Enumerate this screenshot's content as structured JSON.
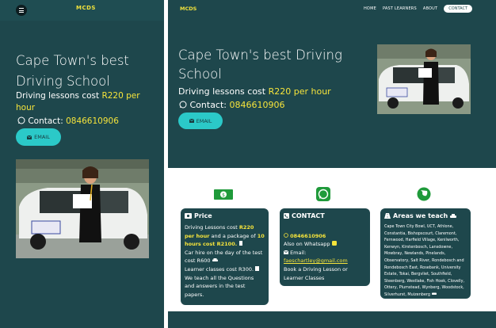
{
  "mobile": {
    "logo": "MCDS",
    "heading": "Cape Town's best Driving School",
    "price_prefix": "Driving lessons cost ",
    "price_value": "R220 per hour",
    "contact_label": "Contact: ",
    "contact_number": "0846610906",
    "email_label": "EMAIL"
  },
  "desktop": {
    "logo": "MCDS",
    "nav": {
      "home": "HOME",
      "past": "PAST LEARNERS",
      "about": "ABOUT",
      "contact": "CONTACT"
    },
    "heading": "Cape Town's best Driving School",
    "price_prefix": "Driving lessons cost ",
    "price_value": "R220 per hour",
    "contact_label": "Contact: ",
    "contact_number": "0846610906",
    "email_label": "EMAIL"
  },
  "cards": {
    "price": {
      "title": "Price",
      "t1": "Driving Lessons cost ",
      "t2": "R220 per hour",
      "t3": " and a package of ",
      "t4": "10 hours cost R2100.",
      "t5": "Car hire on the day of the test cost R600",
      "t6": "Learner classes cost R300.",
      "t7": "We teach all the Questions and answers in the test papers."
    },
    "contact": {
      "title": "CONTACT",
      "phone": "0846610906",
      "whatsapp": "Also on Whatsapp",
      "email_label": "Email:",
      "email": "faeschartley@gmail.com",
      "book": "Book a Driving Lesson or Learner Classes"
    },
    "areas": {
      "title": "Areas we teach",
      "text": "Cape Town City Bowl, UCT, Athlone, Constantia, Bishopscourt, Claremont, Fernwood, Harfield Village, Kenilworth, Kenwyn, Kirstenbosch, Lansdowne, Mowbray, Newlands, Pinelands, Observatory, Salt River, Rondebosch and Rondebosch East, Rosebank, University Estate, Tokai, Bergvliet, Southfield, Steenberg, Westlake, Fish Hoek, Clovelly, Ottery, Plumstead, Wynberg, Woodstock, Silverhurst, Muizenberg"
    }
  },
  "colors": {
    "dark_teal": "#1e474c",
    "accent_cyan": "#2bc9c8",
    "accent_yellow": "#f6e43b",
    "icon_green": "#1f9a3a"
  }
}
